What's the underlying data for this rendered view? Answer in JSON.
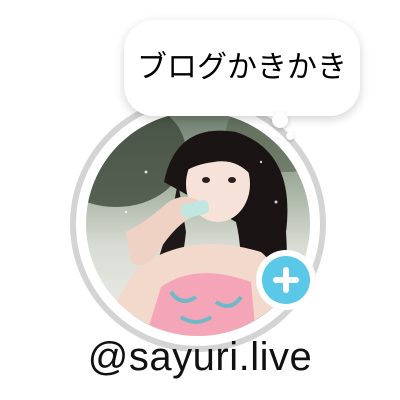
{
  "status_bubble": {
    "text": "ブログかきかき"
  },
  "avatar": {
    "icon": "profile-photo"
  },
  "add_button": {
    "icon": "plus-icon",
    "color": "#5ac8e6"
  },
  "profile": {
    "username": "@sayuri.live"
  },
  "colors": {
    "ring": "#d4d4d4",
    "accent": "#5ac8e6",
    "text": "#111111"
  }
}
